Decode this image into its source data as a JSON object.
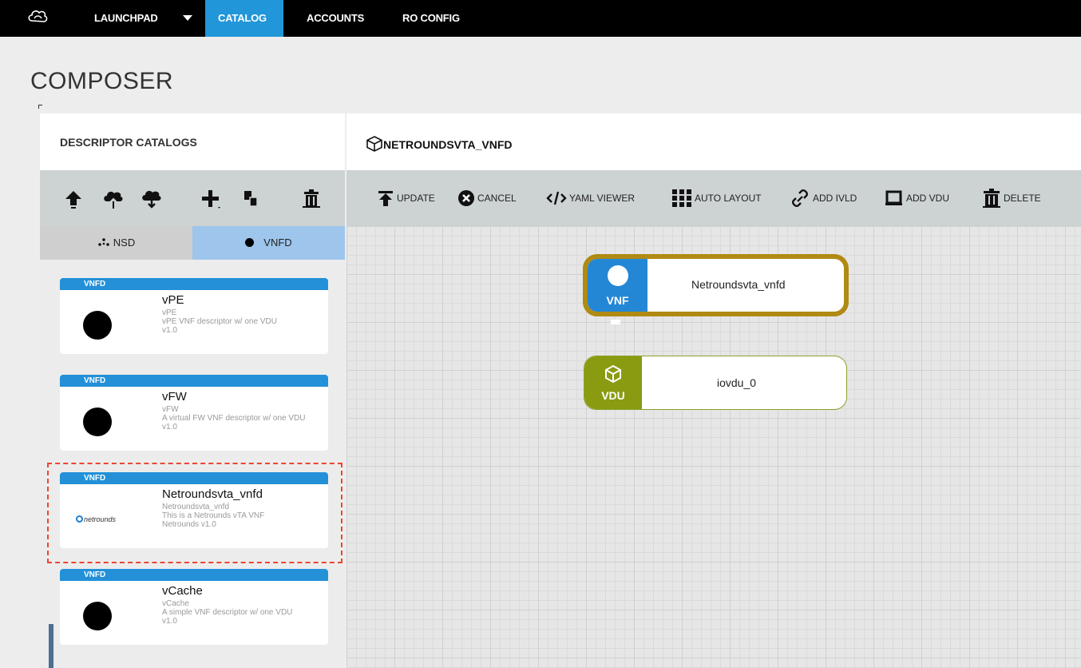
{
  "nav": {
    "items": [
      "LAUNCHPAD",
      "CATALOG",
      "ACCOUNTS",
      "RO CONFIG"
    ],
    "active": "CATALOG"
  },
  "page_title": "COMPOSER",
  "left_panel": {
    "header": "DESCRIPTOR CATALOGS",
    "tools": [
      "upload-icon",
      "cloud-upload-icon",
      "cloud-download-icon",
      "add-icon",
      "copy-icon",
      "trash-icon"
    ],
    "tabs": [
      {
        "label": "NSD",
        "icon": "nsd-dots-icon"
      },
      {
        "label": "VNFD",
        "icon": "vnfd-dot-icon"
      }
    ],
    "cards": [
      {
        "band": "VNFD",
        "title": "vPE",
        "name": "vPE",
        "desc": "vPE VNF descriptor w/ one VDU",
        "version": "v1.0"
      },
      {
        "band": "VNFD",
        "title": "vFW",
        "name": "vFW",
        "desc": "A virtual FW VNF descriptor w/ one VDU",
        "version": "v1.0"
      },
      {
        "band": "VNFD",
        "title": "Netroundsvta_vnfd",
        "name": "Netroundsvta_vnfd",
        "desc": "This is a Netrounds vTA VNF",
        "version": "Netrounds v1.0",
        "logo": "netrounds"
      },
      {
        "band": "VNFD",
        "title": "vCache",
        "name": "vCache",
        "desc": "A simple VNF descriptor w/ one VDU",
        "version": "v1.0"
      }
    ]
  },
  "right_panel": {
    "title": "NETROUNDSVTA_VNFD",
    "toolbar": {
      "update": "UPDATE",
      "cancel": "CANCEL",
      "yaml": "YAML VIEWER",
      "auto_layout": "AUTO LAYOUT",
      "add_ivld": "ADD IVLD",
      "add_vdu": "ADD VDU",
      "delete": "DELETE"
    },
    "nodes": {
      "vnf": {
        "type": "VNF",
        "name": "Netroundsvta_vnfd"
      },
      "vdu": {
        "type": "VDU",
        "name": "iovdu_0"
      }
    }
  },
  "colors": {
    "nav_active": "#2196d9",
    "vnf_blue": "#2387d6",
    "vdu_green": "#8a9b11",
    "selection_gold": "#b08a12",
    "card_band": "#2390d8"
  }
}
